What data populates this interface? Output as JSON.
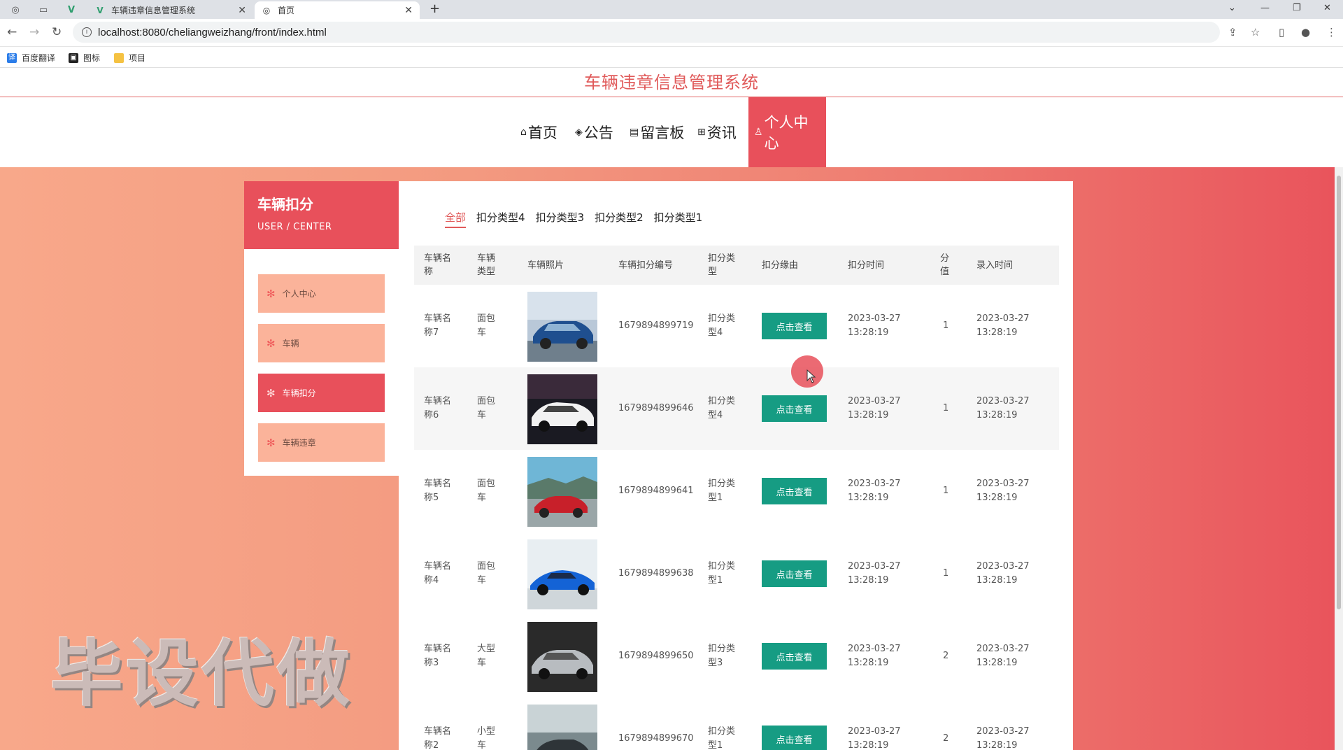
{
  "browser": {
    "tabs": [
      {
        "label": "车辆违章信息管理系统",
        "active": false
      },
      {
        "label": "首页",
        "active": true
      }
    ],
    "url": "localhost:8080/cheliangweizhang/front/index.html",
    "bookmarks": [
      "百度翻译",
      "图标",
      "项目"
    ]
  },
  "site": {
    "title": "车辆违章信息管理系统",
    "nav": [
      {
        "label": "首页",
        "icon": "home-icon"
      },
      {
        "label": "公告",
        "icon": "layers-icon"
      },
      {
        "label": "留言板",
        "icon": "board-icon"
      },
      {
        "label": "资讯",
        "icon": "grid-icon"
      },
      {
        "label": "个人中心",
        "icon": "user-icon",
        "active": true
      }
    ]
  },
  "sidebar": {
    "title": "车辆扣分",
    "subtitle": "USER / CENTER",
    "items": [
      {
        "label": "个人中心",
        "active": false
      },
      {
        "label": "车辆",
        "active": false
      },
      {
        "label": "车辆扣分",
        "active": true
      },
      {
        "label": "车辆违章",
        "active": false
      }
    ]
  },
  "filters": [
    {
      "label": "全部",
      "active": true
    },
    {
      "label": "扣分类型4"
    },
    {
      "label": "扣分类型3"
    },
    {
      "label": "扣分类型2"
    },
    {
      "label": "扣分类型1"
    }
  ],
  "table": {
    "headers": [
      "车辆名称",
      "车辆类型",
      "车辆照片",
      "车辆扣分编号",
      "扣分类型",
      "扣分缘由",
      "扣分时间",
      "分值",
      "录入时间"
    ],
    "button_label": "点击查看",
    "rows": [
      {
        "name": "车辆名称7",
        "type": "面包车",
        "code": "1679894899719",
        "ktype": "扣分类型4",
        "time": "2023-03-27 13:28:19",
        "score": "1",
        "entry": "2023-03-27 13:28:19",
        "photo": "blue-sedan"
      },
      {
        "name": "车辆名称6",
        "type": "面包车",
        "code": "1679894899646",
        "ktype": "扣分类型4",
        "time": "2023-03-27 13:28:19",
        "score": "1",
        "entry": "2023-03-27 13:28:19",
        "photo": "white-sedan"
      },
      {
        "name": "车辆名称5",
        "type": "面包车",
        "code": "1679894899641",
        "ktype": "扣分类型1",
        "time": "2023-03-27 13:28:19",
        "score": "1",
        "entry": "2023-03-27 13:28:19",
        "photo": "red-car-coast"
      },
      {
        "name": "车辆名称4",
        "type": "面包车",
        "code": "1679894899638",
        "ktype": "扣分类型1",
        "time": "2023-03-27 13:28:19",
        "score": "1",
        "entry": "2023-03-27 13:28:19",
        "photo": "blue-sports-car"
      },
      {
        "name": "车辆名称3",
        "type": "大型车",
        "code": "1679894899650",
        "ktype": "扣分类型3",
        "time": "2023-03-27 13:28:19",
        "score": "2",
        "entry": "2023-03-27 13:28:19",
        "photo": "silver-sedan"
      },
      {
        "name": "车辆名称2",
        "type": "小型车",
        "code": "1679894899670",
        "ktype": "扣分类型1",
        "time": "2023-03-27 13:28:19",
        "score": "2",
        "entry": "2023-03-27 13:28:19",
        "photo": "dark-car"
      }
    ]
  },
  "watermark": "毕设代做",
  "colors": {
    "accent": "#e8505b",
    "button": "#169c83"
  }
}
